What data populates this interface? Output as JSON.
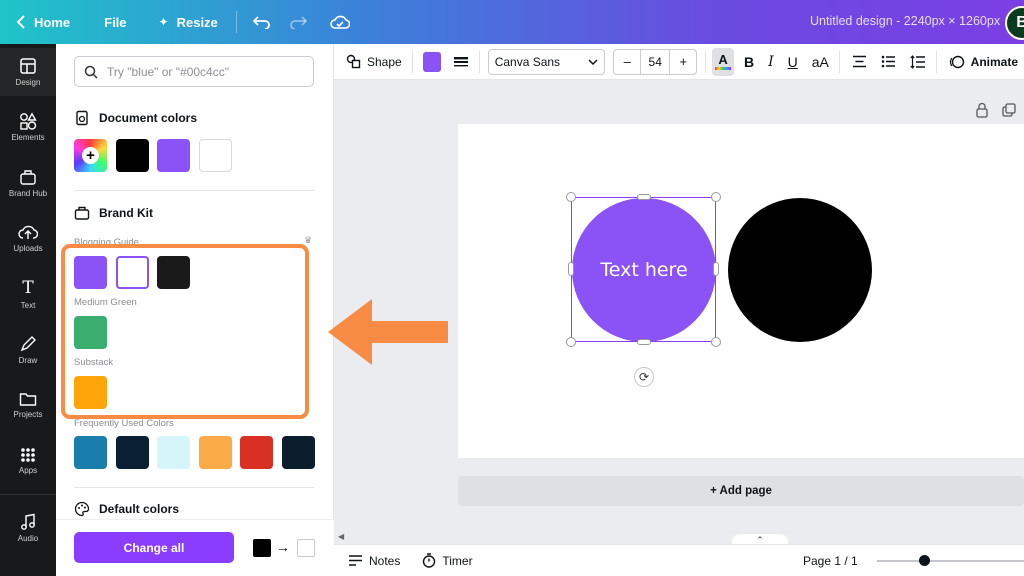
{
  "header": {
    "home_label": "Home",
    "file_label": "File",
    "resize_label": "Resize",
    "doc_title": "Untitled design - 2240px × 1260px",
    "avatar_initial": "B"
  },
  "rail": {
    "items": [
      {
        "label": "Design",
        "icon": "layout-icon"
      },
      {
        "label": "Elements",
        "icon": "shapes-icon"
      },
      {
        "label": "Brand Hub",
        "icon": "brand-icon"
      },
      {
        "label": "Uploads",
        "icon": "cloud-upload-icon"
      },
      {
        "label": "Text",
        "icon": "text-icon"
      },
      {
        "label": "Draw",
        "icon": "pen-icon"
      },
      {
        "label": "Projects",
        "icon": "folder-icon"
      },
      {
        "label": "Apps",
        "icon": "grid-icon"
      },
      {
        "label": "Audio",
        "icon": "music-icon"
      }
    ]
  },
  "panel": {
    "search_placeholder": "Try \"blue\" or \"#00c4cc\"",
    "document_colors_title": "Document colors",
    "document_colors": [
      "#000000",
      "#8b52f6",
      "#ffffff"
    ],
    "brand_kit_title": "Brand Kit",
    "groups": [
      {
        "name": "Blogging Guide",
        "colors": [
          "#8b52f6",
          "#ffffff",
          "#1a1a1a"
        ]
      },
      {
        "name": "Medium Green",
        "colors": [
          "#3aae6f"
        ]
      },
      {
        "name": "Substack",
        "colors": [
          "#ffa50a"
        ]
      }
    ],
    "frequently_used_title": "Frequently Used Colors",
    "frequently_used": [
      "#1a7ead",
      "#0b1f33",
      "#d6f5fb",
      "#fbaa48",
      "#d83022",
      "#0c1d2e"
    ],
    "default_colors_title": "Default colors",
    "change_all_label": "Change all",
    "from_color": "#000000",
    "to_color": "#ffffff"
  },
  "toolbar": {
    "shape_label": "Shape",
    "fill_color": "#8b52f6",
    "font_name": "Canva Sans",
    "font_size": "54",
    "minus": "–",
    "plus": "+",
    "bold": "B",
    "italic": "I",
    "underline": "U",
    "case_label": "aA",
    "animate_label": "Animate"
  },
  "canvas": {
    "purple_circle_text": "Text here",
    "purple_color": "#8b52f6",
    "black_color": "#000000",
    "add_page_label": "+ Add page"
  },
  "bottom": {
    "notes_label": "Notes",
    "timer_label": "Timer",
    "page_indicator": "Page 1 / 1"
  },
  "annotation": {
    "color": "#f98c45"
  }
}
